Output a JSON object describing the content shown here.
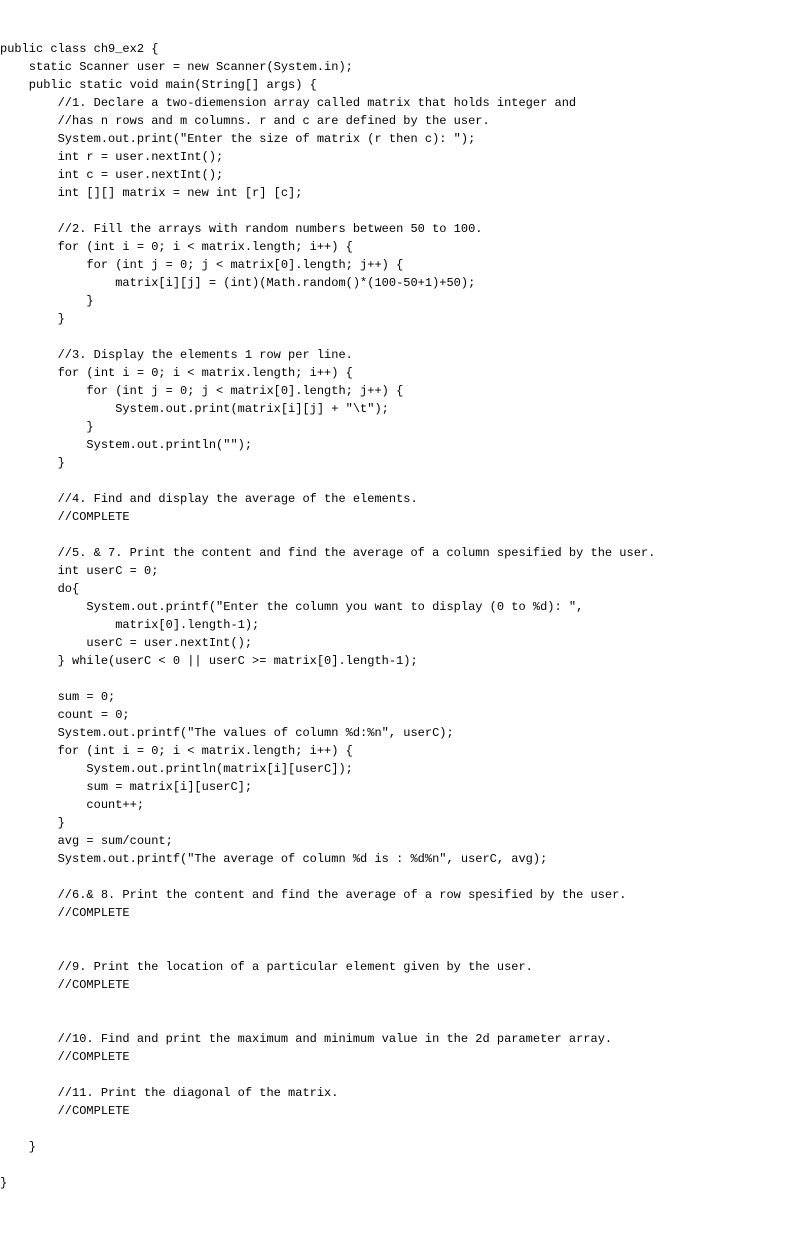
{
  "code": {
    "line01": "public class ch9_ex2 {",
    "line02": "    static Scanner user = new Scanner(System.in);",
    "line03": "    public static void main(String[] args) {",
    "line04": "        //1. Declare a two-diemension array called matrix that holds integer and",
    "line05": "        //has n rows and m columns. r and c are defined by the user.",
    "line06": "        System.out.print(\"Enter the size of matrix (r then c): \");",
    "line07": "        int r = user.nextInt();",
    "line08": "        int c = user.nextInt();",
    "line09": "        int [][] matrix = new int [r] [c];",
    "line10": "",
    "line11": "        //2. Fill the arrays with random numbers between 50 to 100.",
    "line12": "        for (int i = 0; i < matrix.length; i++) {",
    "line13": "            for (int j = 0; j < matrix[0].length; j++) {",
    "line14": "                matrix[i][j] = (int)(Math.random()*(100-50+1)+50);",
    "line15": "            }",
    "line16": "        }",
    "line17": "",
    "line18": "        //3. Display the elements 1 row per line.",
    "line19": "        for (int i = 0; i < matrix.length; i++) {",
    "line20": "            for (int j = 0; j < matrix[0].length; j++) {",
    "line21": "                System.out.print(matrix[i][j] + \"\\t\");",
    "line22": "            }",
    "line23": "            System.out.println(\"\");",
    "line24": "        }",
    "line25": "",
    "line26": "        //4. Find and display the average of the elements.",
    "line27": "        //COMPLETE",
    "line28": "",
    "line29": "        //5. & 7. Print the content and find the average of a column spesified by the user.",
    "line30": "        int userC = 0;",
    "line31": "        do{",
    "line32": "            System.out.printf(\"Enter the column you want to display (0 to %d): \",",
    "line33": "                matrix[0].length-1);",
    "line34": "            userC = user.nextInt();",
    "line35": "        } while(userC < 0 || userC >= matrix[0].length-1);",
    "line36": "",
    "line37": "        sum = 0;",
    "line38": "        count = 0;",
    "line39": "        System.out.printf(\"The values of column %d:%n\", userC);",
    "line40": "        for (int i = 0; i < matrix.length; i++) {",
    "line41": "            System.out.println(matrix[i][userC]);",
    "line42": "            sum = matrix[i][userC];",
    "line43": "            count++;",
    "line44": "        }",
    "line45": "        avg = sum/count;",
    "line46": "        System.out.printf(\"The average of column %d is : %d%n\", userC, avg);",
    "line47": "",
    "line48": "        //6.& 8. Print the content and find the average of a row spesified by the user.",
    "line49": "        //COMPLETE",
    "line50": "",
    "line51": "",
    "line52": "        //9. Print the location of a particular element given by the user.",
    "line53": "        //COMPLETE",
    "line54": "",
    "line55": "",
    "line56": "        //10. Find and print the maximum and minimum value in the 2d parameter array.",
    "line57": "        //COMPLETE",
    "line58": "",
    "line59": "        //11. Print the diagonal of the matrix.",
    "line60": "        //COMPLETE",
    "line61": "",
    "line62": "    }",
    "line63": "",
    "line64": "}"
  }
}
